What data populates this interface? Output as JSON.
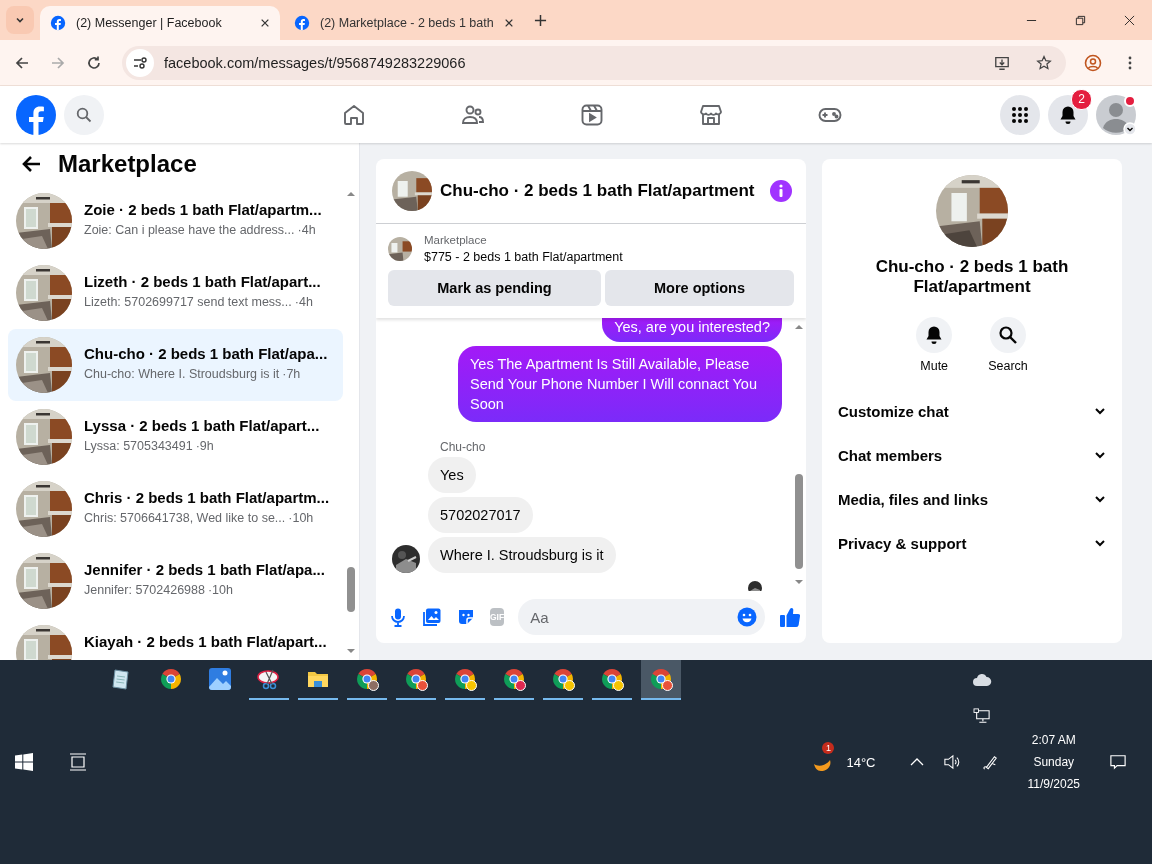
{
  "browser": {
    "tabs": [
      {
        "title": "(2) Messenger | Facebook",
        "selected": true
      },
      {
        "title": "(2) Marketplace - 2 beds 1 bath",
        "selected": false
      }
    ],
    "nav": [
      {
        "kind": "back",
        "disabled": false
      },
      {
        "kind": "forward",
        "disabled": true
      },
      {
        "kind": "reload",
        "disabled": false
      }
    ],
    "url": "facebook.com/messages/t/9568749283229066"
  },
  "header": {
    "nav": [
      {
        "kind": "home",
        "selected": false
      },
      {
        "kind": "friends",
        "selected": false
      },
      {
        "kind": "video",
        "selected": false
      },
      {
        "kind": "store",
        "selected": false
      },
      {
        "kind": "gaming",
        "selected": false
      }
    ],
    "notification_count": "2"
  },
  "sidebar": {
    "title": "Marketplace",
    "conversations": [
      {
        "title": "Zoie · 2 beds 1 bath Flat/apartm...",
        "preview": "Zoie: Can i please have the address...",
        "time": "·4h",
        "selected": false
      },
      {
        "title": "Lizeth · 2 beds 1 bath Flat/apart...",
        "preview": "Lizeth: 5702699717 send text mess...",
        "time": "·4h",
        "selected": false
      },
      {
        "title": "Chu-cho · 2 beds 1 bath Flat/apa...",
        "preview": "Chu-cho: Where I. Stroudsburg is it",
        "time": "·7h",
        "selected": true
      },
      {
        "title": "Lyssa · 2 beds 1 bath Flat/apart...",
        "preview": "Lyssa: 5705343491",
        "time": "·9h",
        "selected": false
      },
      {
        "title": "Chris · 2 beds 1 bath Flat/apartm...",
        "preview": "Chris: 5706641738, Wed like to se...",
        "time": "·10h",
        "selected": false
      },
      {
        "title": "Jennifer · 2 beds 1 bath Flat/apa...",
        "preview": "Jennifer: 5702426988",
        "time": "·10h",
        "selected": false
      },
      {
        "title": "Kiayah · 2 beds 1 bath Flat/apart...",
        "selected": false
      }
    ]
  },
  "chat": {
    "title": "Chu-cho · 2 beds 1 bath Flat/apartment",
    "listing": {
      "source": "Marketplace",
      "summary": "$775 - 2 beds 1 bath Flat/apartment"
    },
    "buttons": [
      "Mark as pending",
      "More options"
    ],
    "messages": [
      {
        "kind": "sent",
        "text": "Yes, are you interested?"
      },
      {
        "kind": "sent",
        "text": "Yes The Apartment Is Still Available, Please Send Your Phone Number I Will connact You Soon"
      },
      {
        "kind": "sender",
        "text": "Chu-cho"
      },
      {
        "kind": "received",
        "text": "Yes",
        "avatar": false
      },
      {
        "kind": "received",
        "text": "5702027017",
        "avatar": false
      },
      {
        "kind": "received",
        "text": "Where I. Stroudsburg is it",
        "avatar": true
      }
    ],
    "gif_label": "GIF",
    "composer": {
      "placeholder": "Aa"
    }
  },
  "info": {
    "name": "Chu-cho · 2 beds 1 bath Flat/apartment",
    "actions": [
      {
        "kind": "mute",
        "label": "Mute"
      },
      {
        "kind": "search",
        "label": "Search"
      }
    ],
    "sections": [
      "Customize chat",
      "Chat members",
      "Media, files and links",
      "Privacy & support"
    ]
  },
  "taskbar": {
    "apps": [
      {
        "kind": "notepad",
        "running": false,
        "selected": false
      },
      {
        "kind": "chrome",
        "running": false,
        "selected": false
      },
      {
        "kind": "photos",
        "running": false,
        "selected": false
      },
      {
        "kind": "snip",
        "running": true,
        "selected": false
      },
      {
        "kind": "folder",
        "running": true,
        "selected": false
      },
      {
        "kind": "chrome",
        "color": "#8d6e63",
        "running": true,
        "selected": false
      },
      {
        "kind": "chrome",
        "color": "#e8513a",
        "running": true,
        "selected": false
      },
      {
        "kind": "chrome",
        "color": "#f6c400",
        "running": true,
        "selected": false
      },
      {
        "kind": "chrome",
        "color": "#e02850",
        "running": true,
        "selected": false
      },
      {
        "kind": "chrome",
        "color": "#f6c400",
        "running": true,
        "selected": false
      },
      {
        "kind": "chrome",
        "color": "#f6c400",
        "running": true,
        "selected": false
      },
      {
        "kind": "chrome",
        "color": "#e8513a",
        "running": true,
        "selected": true
      }
    ],
    "weather_badge": "1",
    "temperature": "14°C",
    "time": "2:07 AM",
    "day": "Sunday",
    "date": "11/9/2025"
  }
}
